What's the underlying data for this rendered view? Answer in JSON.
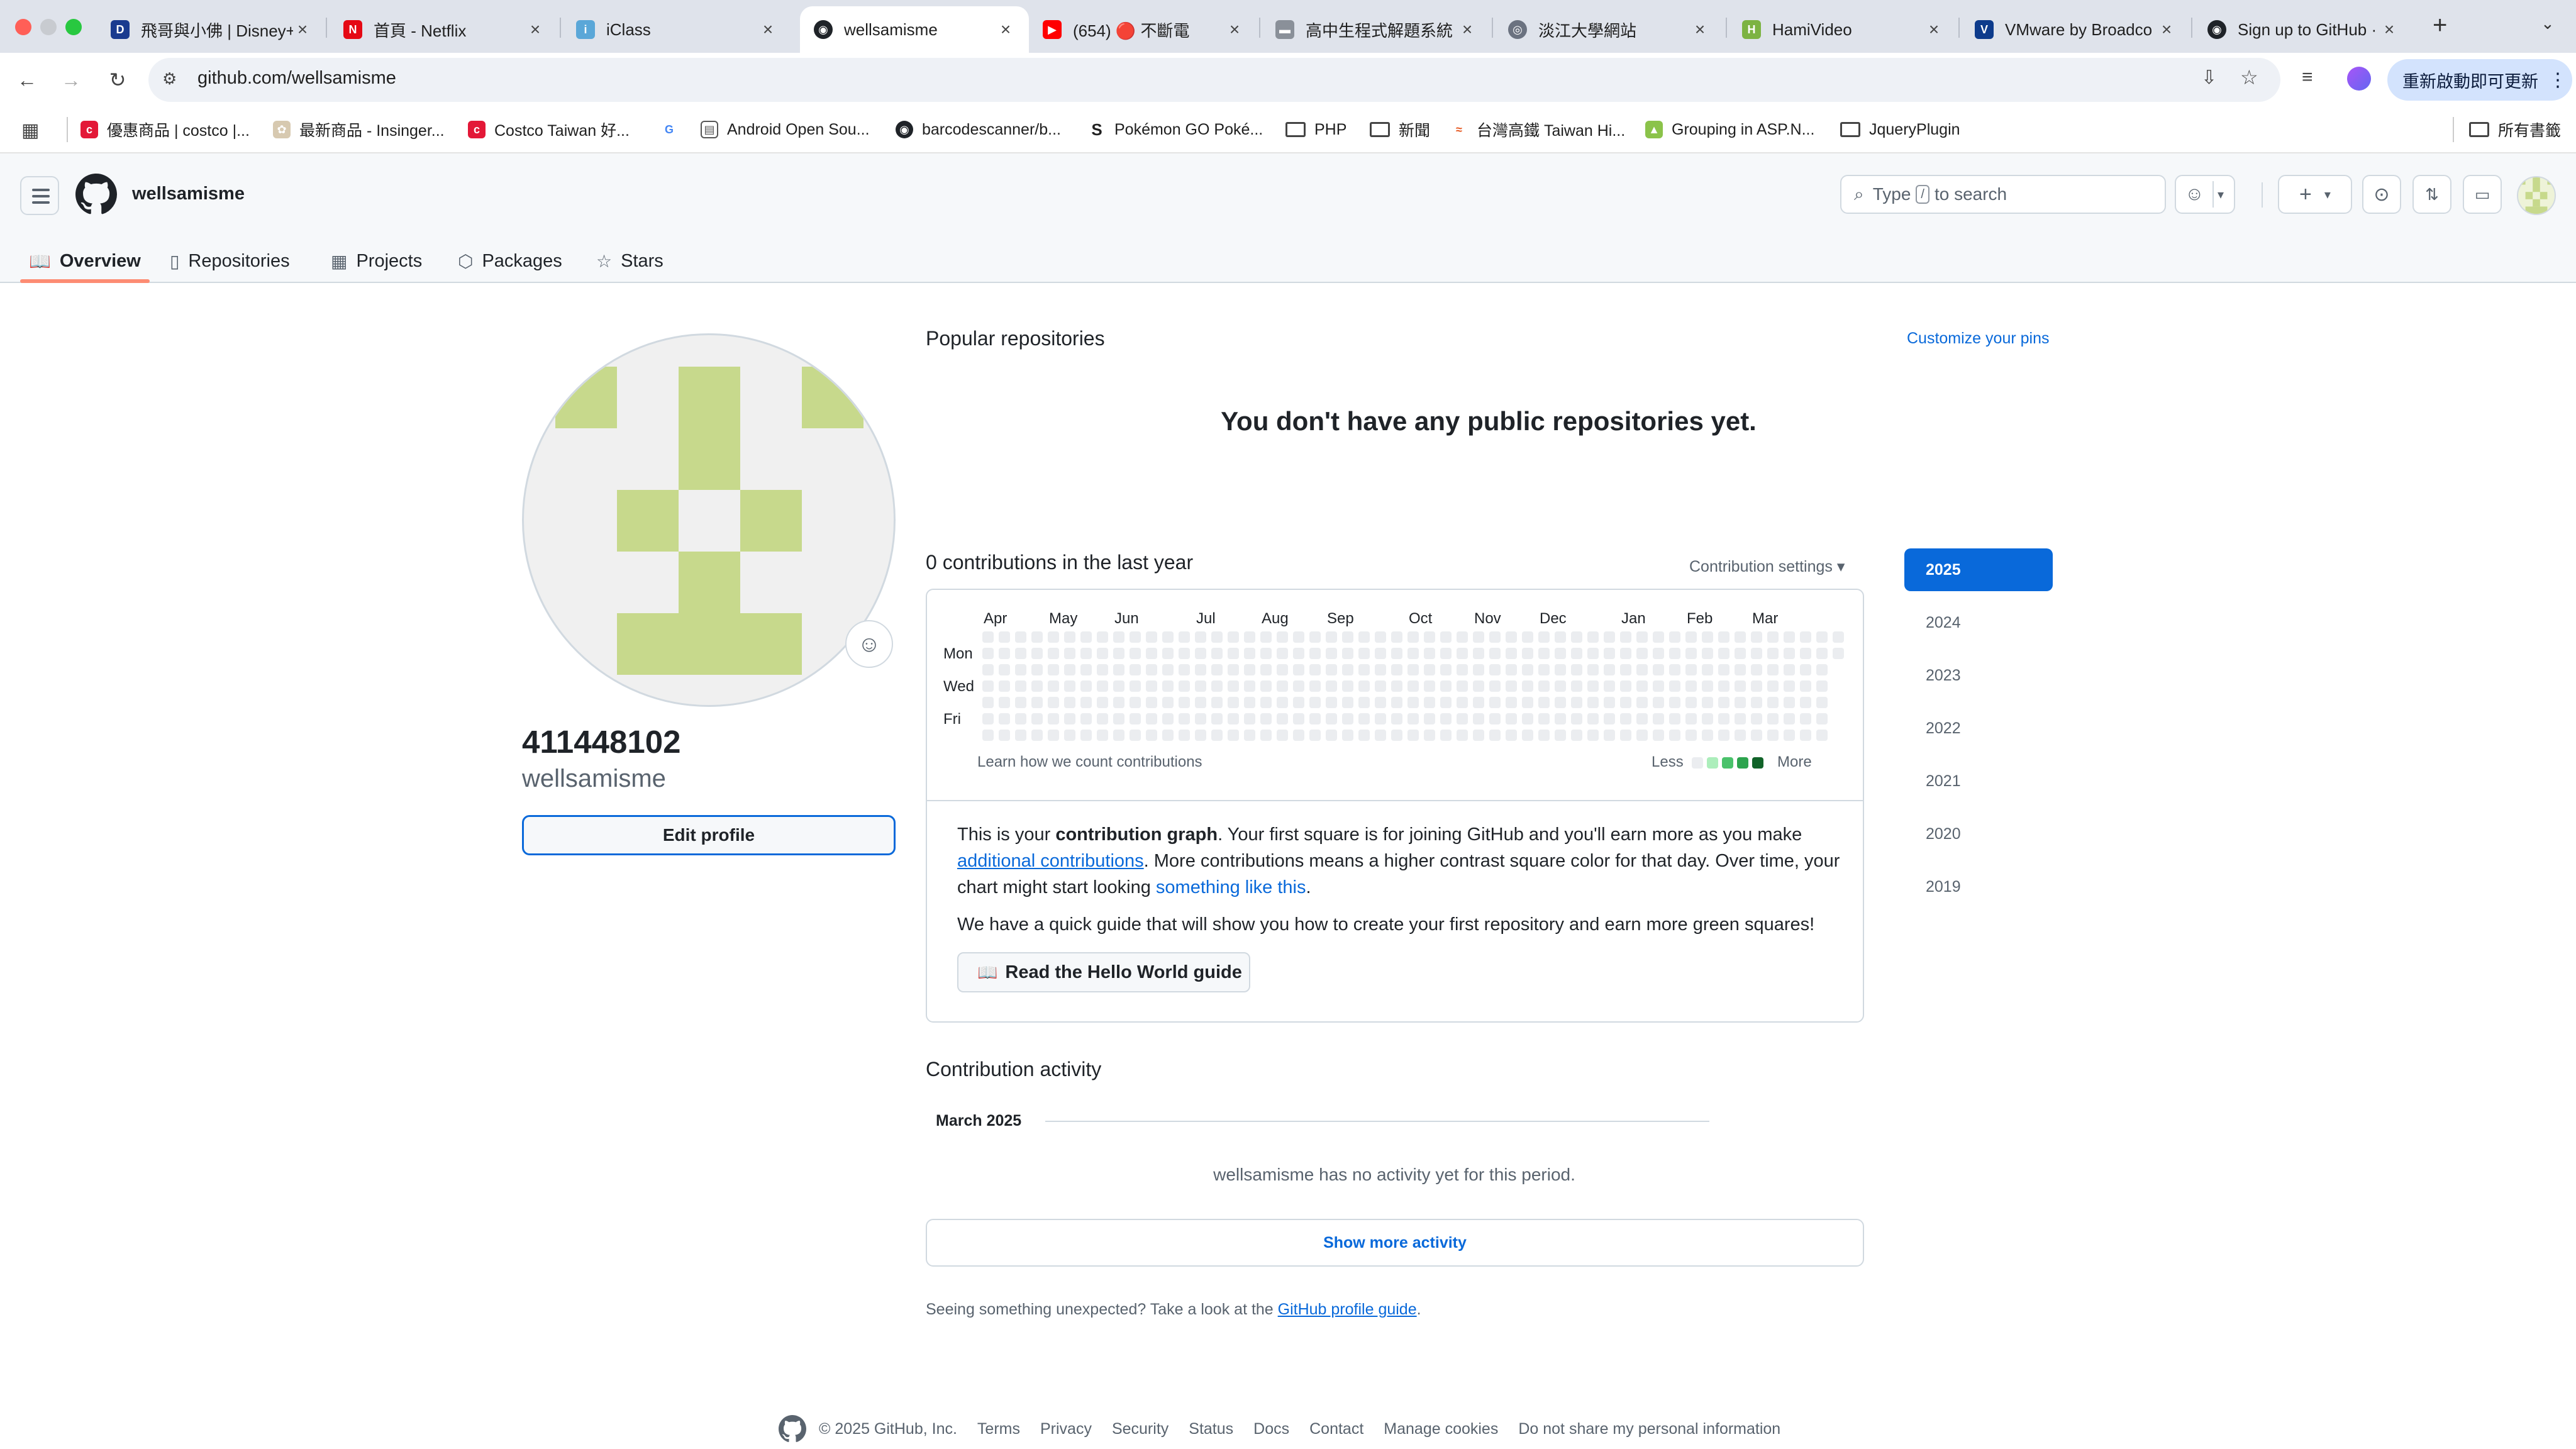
{
  "browser": {
    "tabs": [
      {
        "title": "飛哥與小佛 | Disney+"
      },
      {
        "title": "首頁 - Netflix"
      },
      {
        "title": "iClass"
      },
      {
        "title": "wellsamisme"
      },
      {
        "title": "(654) 🔴 不斷電"
      },
      {
        "title": "高中生程式解題系統"
      },
      {
        "title": "淡江大學網站"
      },
      {
        "title": "HamiVideo"
      },
      {
        "title": "VMware by Broadco"
      },
      {
        "title": "Sign up to GitHub ·"
      }
    ],
    "url": "github.com/wellsamisme",
    "update_button": "重新啟動即可更新",
    "bookmarks": [
      {
        "label": "優惠商品 | costco |..."
      },
      {
        "label": "最新商品 - Insinger..."
      },
      {
        "label": "Costco Taiwan 好..."
      },
      {
        "label": ""
      },
      {
        "label": "Android Open Sou..."
      },
      {
        "label": "barcodescanner/b..."
      },
      {
        "label": "Pokémon GO Poké..."
      },
      {
        "label": "PHP"
      },
      {
        "label": "新聞"
      },
      {
        "label": "台灣高鐵 Taiwan Hi..."
      },
      {
        "label": "Grouping in ASP.N..."
      },
      {
        "label": "JqueryPlugin"
      }
    ],
    "all_bookmarks": "所有書籤"
  },
  "header": {
    "username": "wellsamisme",
    "search_prefix": "Type",
    "search_key": "/",
    "search_suffix": "to search"
  },
  "nav": [
    {
      "label": "Overview"
    },
    {
      "label": "Repositories"
    },
    {
      "label": "Projects"
    },
    {
      "label": "Packages"
    },
    {
      "label": "Stars"
    }
  ],
  "profile": {
    "name": "411448102",
    "login": "wellsamisme",
    "edit_button": "Edit profile"
  },
  "popular": {
    "heading": "Popular repositories",
    "customize": "Customize your pins",
    "empty": "You don't have any public repositories yet."
  },
  "contributions": {
    "heading": "0 contributions in the last year",
    "settings": "Contribution settings ▾",
    "months": [
      "Apr",
      "May",
      "Jun",
      "Jul",
      "Aug",
      "Sep",
      "Oct",
      "Nov",
      "Dec",
      "Jan",
      "Feb",
      "Mar"
    ],
    "days": [
      "Mon",
      "Wed",
      "Fri"
    ],
    "learn": "Learn how we count contributions",
    "less": "Less",
    "more": "More",
    "colors": [
      "#ebedf0",
      "#aceebb",
      "#4ac26b",
      "#2da44e",
      "#116329"
    ]
  },
  "info": {
    "p1_a": "This is your ",
    "p1_b": "contribution graph",
    "p1_c": ". Your first square is for joining GitHub and you'll earn more as you make ",
    "p1_link1": "additional contributions",
    "p1_d": ". More contributions means a higher contrast square color for that day. Over time, your chart might start looking ",
    "p1_link2": "something like this",
    "p1_e": ".",
    "p2": "We have a quick guide that will show you how to create your first repository and earn more green squares!",
    "guide_button": "Read the Hello World guide"
  },
  "activity": {
    "heading": "Contribution activity",
    "month": "March 2025",
    "empty": "wellsamisme has no activity yet for this period.",
    "show_more": "Show more activity",
    "unexpected_text": "Seeing something unexpected? Take a look at the ",
    "unexpected_link": "GitHub profile guide",
    "unexpected_end": "."
  },
  "years": [
    "2025",
    "2024",
    "2023",
    "2022",
    "2021",
    "2020",
    "2019"
  ],
  "footer": {
    "copyright": "© 2025 GitHub, Inc.",
    "links": [
      "Terms",
      "Privacy",
      "Security",
      "Status",
      "Docs",
      "Contact",
      "Manage cookies",
      "Do not share my personal information"
    ]
  }
}
